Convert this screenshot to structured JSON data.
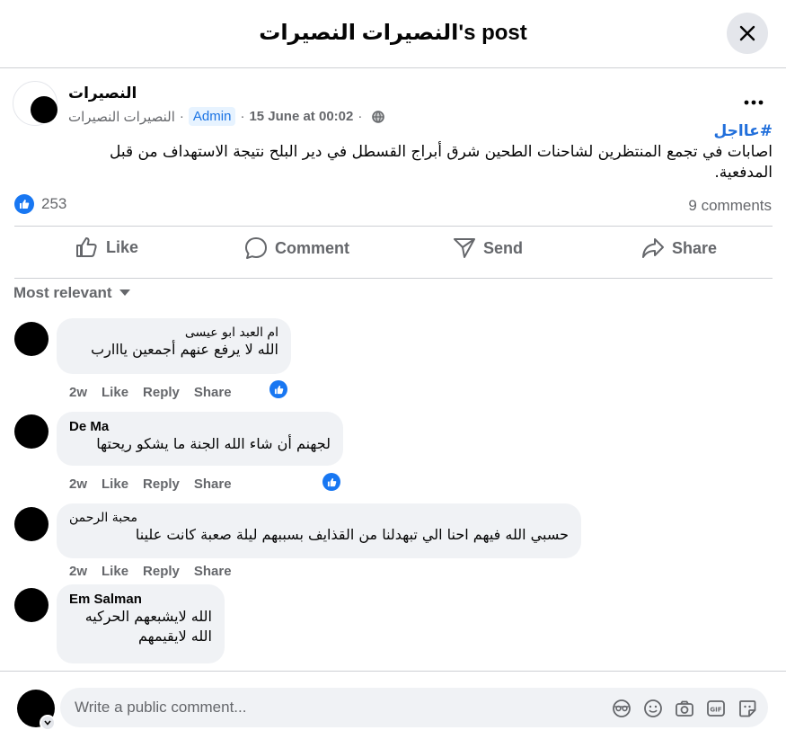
{
  "header": {
    "title": "النصيرات النصيرات's post"
  },
  "post": {
    "author": "النصيرات",
    "group": "النصيرات النصيرات",
    "badge": "Admin",
    "date": "15 June at 00:02",
    "hashtag": "#عااجل",
    "text": "اصابات في تجمع المنتظرين لشاحنات الطحين شرق أبراج القسطل في دير البلح نتيجة الاستهداف من قبل المدفعية.",
    "reactions_count": "253",
    "comments_count": "9 comments"
  },
  "actions": {
    "like": "Like",
    "comment": "Comment",
    "send": "Send",
    "share": "Share"
  },
  "sort_label": "Most relevant",
  "comments": [
    {
      "name": "ام العبد ابو عيسى",
      "text": "الله لا يرفع عنهم أجمعين يااارب",
      "time": "2w",
      "like": "Like",
      "reply": "Reply",
      "share": "Share"
    },
    {
      "name": "De Ma",
      "text": "لجهنم أن شاء الله الجنة ما يشكو ريحتها",
      "time": "2w",
      "like": "Like",
      "reply": "Reply",
      "share": "Share"
    },
    {
      "name": "محبة الرحمن",
      "text": "حسبي الله فيهم احنا الي تبهدلنا من القذايف بسببهم ليلة صعبة كانت علينا",
      "time": "2w",
      "like": "Like",
      "reply": "Reply",
      "share": "Share"
    },
    {
      "name": "Em Salman",
      "text_line1": "الله لايشبعهم الحركيه",
      "text_line2": "الله لايقيمهم"
    }
  ],
  "composer": {
    "placeholder": "Write a public comment..."
  },
  "colors": {
    "accent": "#1877f2",
    "bubble": "#f0f2f5",
    "muted": "#65676b"
  }
}
